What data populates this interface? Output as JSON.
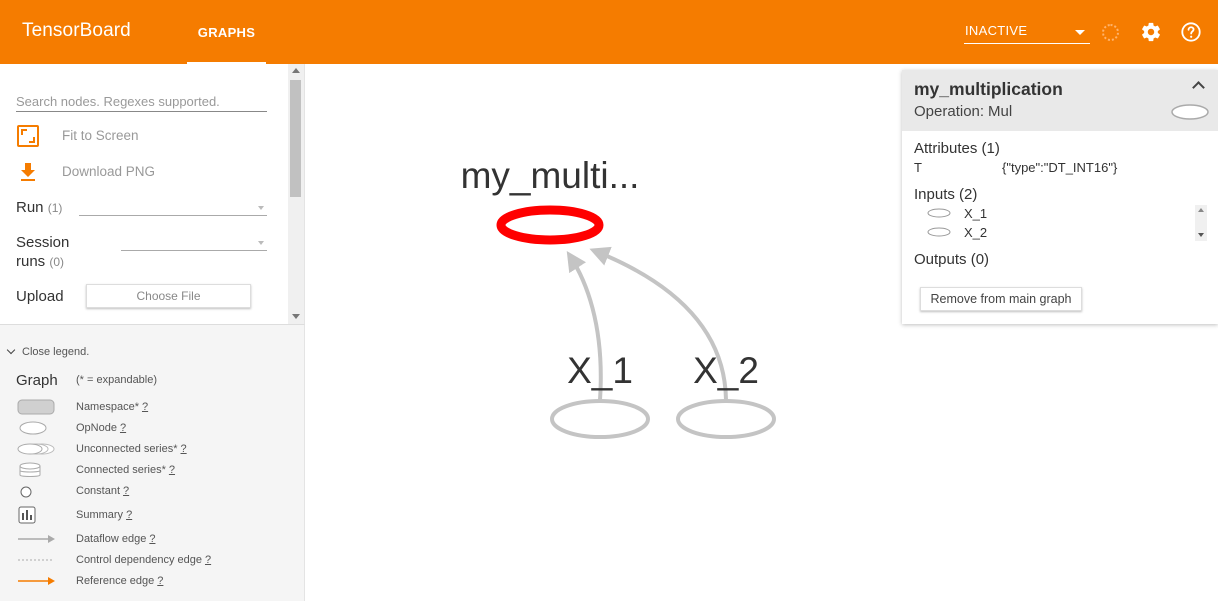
{
  "app": {
    "title": "TensorBoard",
    "accent_color": "#f57c00"
  },
  "header": {
    "tabs": [
      {
        "label": "GRAPHS",
        "active": true
      }
    ],
    "run_selector": {
      "value": "INACTIVE"
    },
    "icons": [
      "spinner-icon",
      "gear-icon",
      "help-icon"
    ]
  },
  "sidebar": {
    "search": {
      "placeholder": "Search nodes. Regexes supported."
    },
    "fit_label": "Fit to Screen",
    "download_label": "Download PNG",
    "run": {
      "label": "Run",
      "count": "(1)"
    },
    "session": {
      "label_line1": "Session",
      "label_line2": "runs",
      "count": "(0)"
    },
    "upload": {
      "label": "Upload",
      "button": "Choose File"
    }
  },
  "legend": {
    "close_label": "Close legend.",
    "title": "Graph",
    "hint": "(* = expandable)",
    "help_mark": "?",
    "items": [
      {
        "label": "Namespace*",
        "icon": "namespace-icon"
      },
      {
        "label": "OpNode",
        "icon": "opnode-icon"
      },
      {
        "label": "Unconnected series*",
        "icon": "unconnected-series-icon"
      },
      {
        "label": "Connected series*",
        "icon": "connected-series-icon"
      },
      {
        "label": "Constant",
        "icon": "constant-icon"
      },
      {
        "label": "Summary",
        "icon": "summary-icon"
      },
      {
        "label": "Dataflow edge",
        "icon": "dataflow-edge-icon"
      },
      {
        "label": "Control dependency edge",
        "icon": "control-edge-icon"
      },
      {
        "label": "Reference edge",
        "icon": "reference-edge-icon"
      }
    ]
  },
  "graph": {
    "selected_node_label": "my_multi...",
    "selected_color": "#ff0000",
    "input_nodes": [
      "X_1",
      "X_2"
    ]
  },
  "info_card": {
    "title": "my_multiplication",
    "operation_label": "Operation:",
    "operation_value": "Mul",
    "attributes_title": "Attributes (1)",
    "attributes": [
      {
        "key": "T",
        "value": "{\"type\":\"DT_INT16\"}"
      }
    ],
    "inputs_title": "Inputs (2)",
    "inputs": [
      "X_1",
      "X_2"
    ],
    "outputs_title": "Outputs (0)",
    "remove_button": "Remove from main graph"
  }
}
